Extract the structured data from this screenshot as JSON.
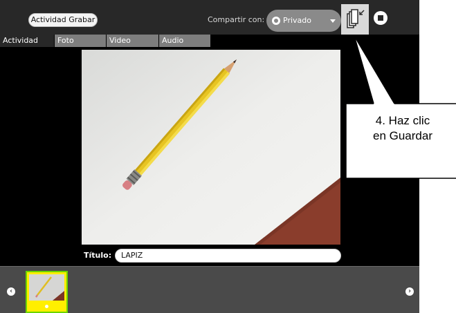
{
  "toolbar": {
    "activity_name": "Actividad Grabar",
    "share_label": "Compartir con:",
    "share_value": "Privado",
    "keep_icon": "keep-icon",
    "stop_icon": "stop-icon"
  },
  "tabs": [
    {
      "label": "Actividad",
      "active": true
    },
    {
      "label": "Foto",
      "active": false
    },
    {
      "label": "Video",
      "active": false
    },
    {
      "label": "Audio",
      "active": false
    }
  ],
  "main": {
    "title_label": "Título:",
    "title_value": "LAPIZ"
  },
  "tray": {
    "prev_icon": "chevron-left-icon",
    "next_icon": "chevron-right-icon"
  },
  "callout": {
    "line1": "4. Haz  clic",
    "line2": "en Guardar"
  },
  "colors": {
    "toolbar": "#282828",
    "tab_inactive": "#7e7e7e",
    "thumb_border": "#6cd400",
    "thumb_bg": "#ffef00"
  }
}
